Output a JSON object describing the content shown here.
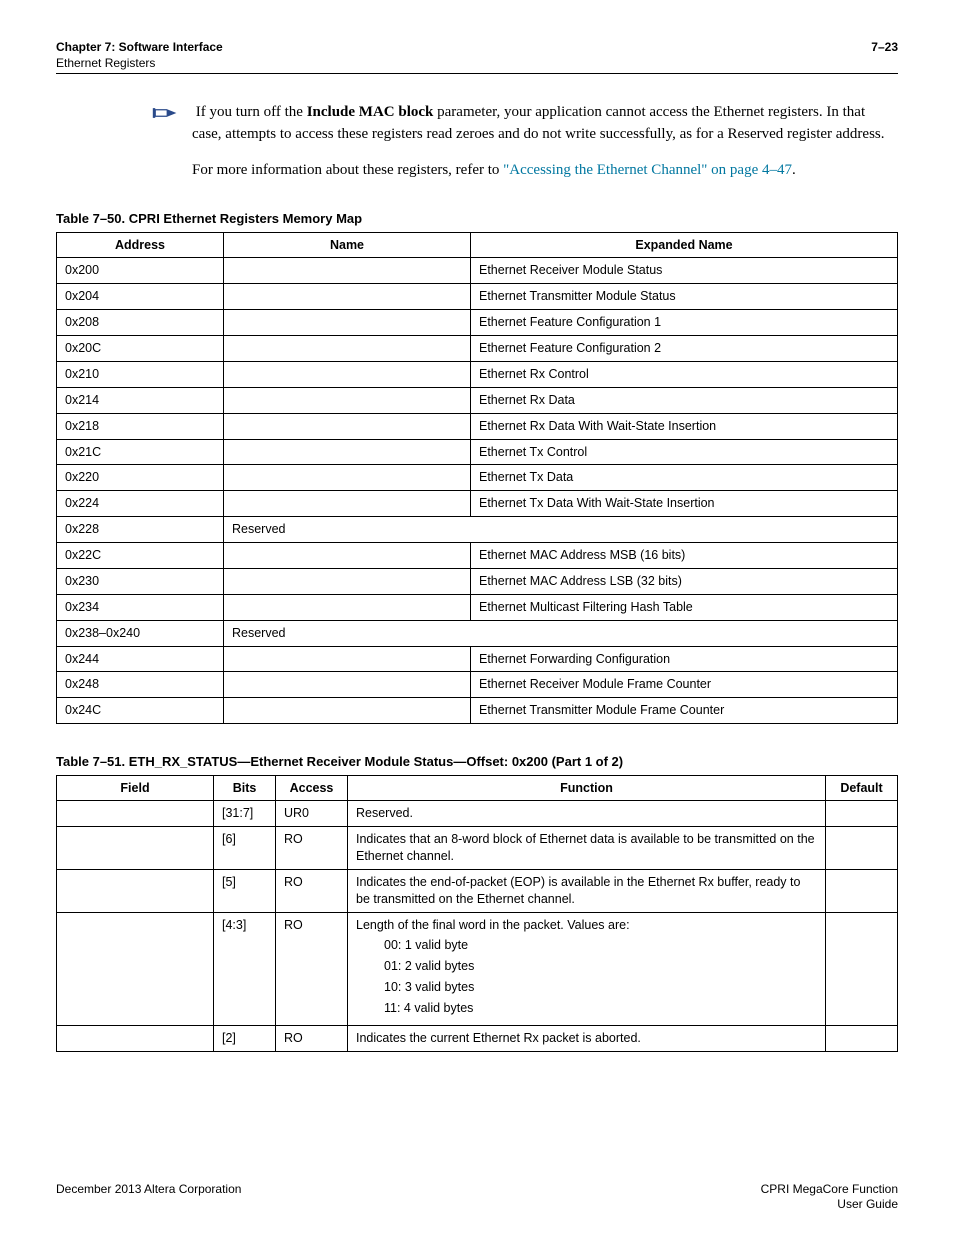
{
  "header": {
    "chapter": "Chapter 7:  Software Interface",
    "section": "Ethernet Registers",
    "page_num": "7–23"
  },
  "note": {
    "p1_a": "If you turn off the ",
    "p1_bold": "Include MAC block",
    "p1_b": " parameter, your application cannot access the Ethernet registers. In that case, attempts to access these registers read zeroes and do not write successfully, as for a Reserved register address.",
    "p2_a": "For more information about these registers, refer to ",
    "p2_link": "\"Accessing the Ethernet Channel\" on page 4–47",
    "p2_b": "."
  },
  "table50": {
    "caption": "Table 7–50.  CPRI Ethernet Registers Memory Map",
    "headers": {
      "c1": "Address",
      "c2": "Name",
      "c3": "Expanded Name"
    },
    "rows": [
      {
        "addr": "0x200",
        "name": "",
        "exp": "Ethernet Receiver Module Status"
      },
      {
        "addr": "0x204",
        "name": "",
        "exp": "Ethernet Transmitter Module Status"
      },
      {
        "addr": "0x208",
        "name": "",
        "exp": "Ethernet Feature Configuration 1"
      },
      {
        "addr": "0x20C",
        "name": "",
        "exp": "Ethernet Feature Configuration 2"
      },
      {
        "addr": "0x210",
        "name": "",
        "exp": "Ethernet Rx Control"
      },
      {
        "addr": "0x214",
        "name": "",
        "exp": "Ethernet Rx Data"
      },
      {
        "addr": "0x218",
        "name": "",
        "exp": "Ethernet Rx Data With Wait-State Insertion"
      },
      {
        "addr": "0x21C",
        "name": "",
        "exp": "Ethernet Tx Control"
      },
      {
        "addr": "0x220",
        "name": "",
        "exp": "Ethernet Tx Data"
      },
      {
        "addr": "0x224",
        "name": "",
        "exp": "Ethernet Tx Data With Wait-State Insertion"
      },
      {
        "addr": "0x228",
        "name": "Reserved",
        "span": true
      },
      {
        "addr": "0x22C",
        "name": "",
        "exp": "Ethernet MAC Address MSB (16 bits)"
      },
      {
        "addr": "0x230",
        "name": "",
        "exp": "Ethernet MAC Address LSB (32 bits)"
      },
      {
        "addr": "0x234",
        "name": "",
        "exp": "Ethernet Multicast Filtering Hash Table"
      },
      {
        "addr": "0x238–0x240",
        "name": "Reserved",
        "span": true
      },
      {
        "addr": "0x244",
        "name": "",
        "exp": "Ethernet Forwarding Configuration"
      },
      {
        "addr": "0x248",
        "name": "",
        "exp": "Ethernet Receiver Module Frame Counter"
      },
      {
        "addr": "0x24C",
        "name": "",
        "exp": "Ethernet Transmitter Module Frame Counter"
      }
    ]
  },
  "table51": {
    "caption": "Table 7–51.  ETH_RX_STATUS—Ethernet Receiver Module Status—Offset: 0x200  (Part 1 of 2)",
    "headers": {
      "c1": "Field",
      "c2": "Bits",
      "c3": "Access",
      "c4": "Function",
      "c5": "Default"
    },
    "rows": [
      {
        "field": "",
        "bits": "[31:7]",
        "access": "UR0",
        "func": "Reserved.",
        "def": ""
      },
      {
        "field": "",
        "bits": "[6]",
        "access": "RO",
        "func": "Indicates that an 8-word block of Ethernet data is available to be transmitted on the Ethernet channel.",
        "def": ""
      },
      {
        "field": "",
        "bits": "[5]",
        "access": "RO",
        "func": "Indicates the end-of-packet (EOP) is available in the Ethernet Rx buffer, ready to be transmitted on the Ethernet channel.",
        "def": ""
      },
      {
        "field": "",
        "bits": "[4:3]",
        "access": "RO",
        "func_intro": "Length of the final word in the packet. Values are:",
        "func_items": [
          "00: 1 valid byte",
          "01: 2 valid bytes",
          "10: 3 valid bytes",
          "11: 4 valid bytes"
        ],
        "def": ""
      },
      {
        "field": "",
        "bits": "[2]",
        "access": "RO",
        "func": "Indicates the current Ethernet Rx packet is aborted.",
        "def": ""
      }
    ]
  },
  "chart_data": [
    {
      "type": "table",
      "title": "Table 7–50. CPRI Ethernet Registers Memory Map",
      "columns": [
        "Address",
        "Name",
        "Expanded Name"
      ],
      "rows": [
        [
          "0x200",
          "",
          "Ethernet Receiver Module Status"
        ],
        [
          "0x204",
          "",
          "Ethernet Transmitter Module Status"
        ],
        [
          "0x208",
          "",
          "Ethernet Feature Configuration 1"
        ],
        [
          "0x20C",
          "",
          "Ethernet Feature Configuration 2"
        ],
        [
          "0x210",
          "",
          "Ethernet Rx Control"
        ],
        [
          "0x214",
          "",
          "Ethernet Rx Data"
        ],
        [
          "0x218",
          "",
          "Ethernet Rx Data With Wait-State Insertion"
        ],
        [
          "0x21C",
          "",
          "Ethernet Tx Control"
        ],
        [
          "0x220",
          "",
          "Ethernet Tx Data"
        ],
        [
          "0x224",
          "",
          "Ethernet Tx Data With Wait-State Insertion"
        ],
        [
          "0x228",
          "Reserved",
          ""
        ],
        [
          "0x22C",
          "",
          "Ethernet MAC Address MSB (16 bits)"
        ],
        [
          "0x230",
          "",
          "Ethernet MAC Address LSB (32 bits)"
        ],
        [
          "0x234",
          "",
          "Ethernet Multicast Filtering Hash Table"
        ],
        [
          "0x238–0x240",
          "Reserved",
          ""
        ],
        [
          "0x244",
          "",
          "Ethernet Forwarding Configuration"
        ],
        [
          "0x248",
          "",
          "Ethernet Receiver Module Frame Counter"
        ],
        [
          "0x24C",
          "",
          "Ethernet Transmitter Module Frame Counter"
        ]
      ]
    },
    {
      "type": "table",
      "title": "Table 7–51. ETH_RX_STATUS—Ethernet Receiver Module Status—Offset: 0x200 (Part 1 of 2)",
      "columns": [
        "Field",
        "Bits",
        "Access",
        "Function",
        "Default"
      ],
      "rows": [
        [
          "",
          "[31:7]",
          "UR0",
          "Reserved.",
          ""
        ],
        [
          "",
          "[6]",
          "RO",
          "Indicates that an 8-word block of Ethernet data is available to be transmitted on the Ethernet channel.",
          ""
        ],
        [
          "",
          "[5]",
          "RO",
          "Indicates the end-of-packet (EOP) is available in the Ethernet Rx buffer, ready to be transmitted on the Ethernet channel.",
          ""
        ],
        [
          "",
          "[4:3]",
          "RO",
          "Length of the final word in the packet. Values are: 00: 1 valid byte; 01: 2 valid bytes; 10: 3 valid bytes; 11: 4 valid bytes",
          ""
        ],
        [
          "",
          "[2]",
          "RO",
          "Indicates the current Ethernet Rx packet is aborted.",
          ""
        ]
      ]
    }
  ],
  "footer": {
    "left": "December 2013  Altera Corporation",
    "right1": "CPRI MegaCore Function",
    "right2": "User Guide"
  }
}
